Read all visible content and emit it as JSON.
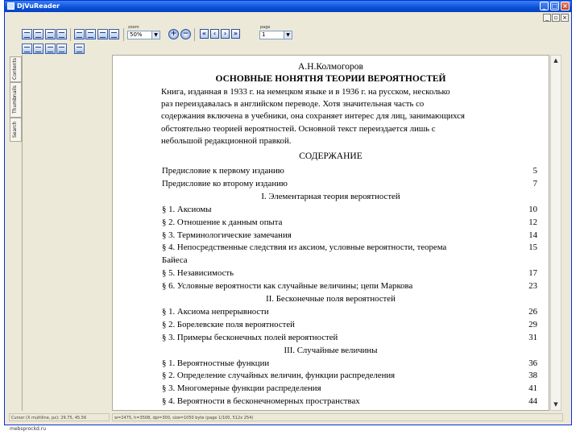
{
  "app": {
    "title": "DjVuReader"
  },
  "toolbar": {
    "zoom_label": "zoom",
    "zoom_value": "50%",
    "page_label": "page",
    "page_value": "1"
  },
  "sidebar": {
    "tabs": [
      "Contents",
      "Thumbnails",
      "Search"
    ]
  },
  "document": {
    "author": "А.Н.Колмогоров",
    "title": "ОСНОВНЫЕ НОНЯТНЯ ТЕОРИИ ВЕРОЯТНОСТЕЙ",
    "paragraph_lines": [
      "Книга, изданная в 1933 г. на немецком языке и в 1936 г. на русском, несколько",
      "раз переиздавалась в английском переводе. Хотя значительная часть со",
      "содержания включена в учебники, она сохраняет интерес для лиц, занимающихся",
      "обстоятельно теорией вероятностей. Основной текст переиздается лишь с",
      "небольшой редакционной правкой."
    ],
    "contents_heading": "СОДЕРЖАНИЕ",
    "toc": [
      {
        "text": "Предисловие к первому изданию",
        "page": "5"
      },
      {
        "text": "Предисловие ко второму изданию",
        "page": "7"
      },
      {
        "part": "I. Элементарная теория вероятностей"
      },
      {
        "text": "§ 1. Аксиомы",
        "page": "10"
      },
      {
        "text": "§ 2. Отношение к данным опыта",
        "page": "12"
      },
      {
        "text": "§ 3. Терминологические замечания",
        "page": "14"
      },
      {
        "text": "§ 4. Непосредственные следствия из аксиом, условные вероятности, теорема",
        "page": "15"
      },
      {
        "text": "Байеса",
        "page": ""
      },
      {
        "text": "§ 5. Независимость",
        "page": "17"
      },
      {
        "text": "§ 6. Условные вероятности как случайные величины; цепи Маркова",
        "page": "23"
      },
      {
        "part": "II. Бесконечные поля вероятностей"
      },
      {
        "text": "§ 1. Аксиома непрерывности",
        "page": "26"
      },
      {
        "text": "§ 2. Борелевские поля вероятностей",
        "page": "29"
      },
      {
        "text": "§ 3. Примеры бесконечных полей вероятностей",
        "page": "31"
      },
      {
        "part": "III. Случайные величины"
      },
      {
        "text": "§ 1. Вероятностные функции",
        "page": "36"
      },
      {
        "text": "§ 2. Определение случайных величин, функции распределения",
        "page": "38"
      },
      {
        "text": "§ 3. Многомерные функции распределения",
        "page": "41"
      },
      {
        "text": "§ 4. Вероятности в бесконечномерных пространствах",
        "page": "44"
      }
    ]
  },
  "statusbar": {
    "left": "Cursor (X multiline, px): 29.75, 45.56",
    "right": "w=2475, h=3508, dpi=300, size=1050 byte (page 1/100, 512x 254)"
  },
  "taskbar": {
    "text": "mebsprockd.ru"
  }
}
